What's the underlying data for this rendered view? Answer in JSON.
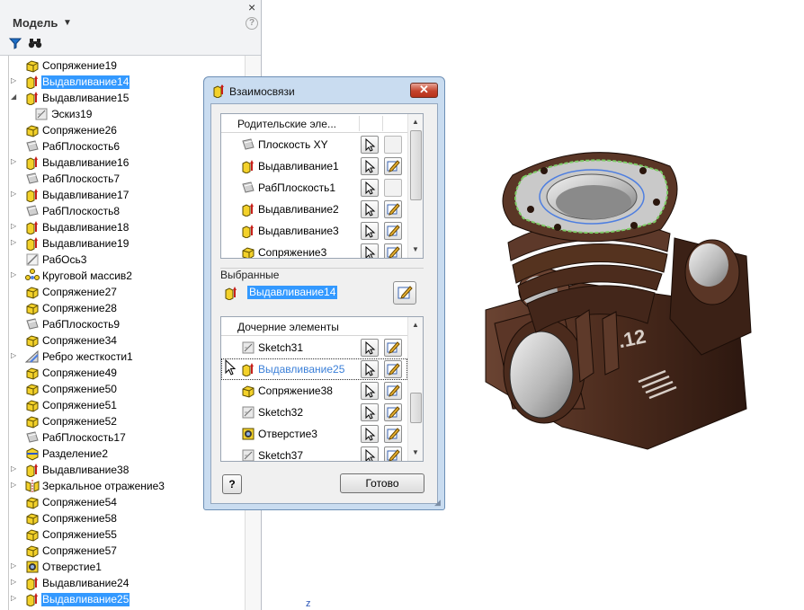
{
  "browser": {
    "title": "Модель",
    "close": "×",
    "help": "?",
    "items": [
      {
        "label": "Сопряжение19",
        "icon": "fillet-icon",
        "expandable": false,
        "selected": false,
        "child": false
      },
      {
        "label": "Выдавливание14",
        "icon": "extrude-icon",
        "expandable": true,
        "selected": true,
        "child": false
      },
      {
        "label": "Выдавливание15",
        "icon": "extrude-icon",
        "expandable": true,
        "expanded": true,
        "selected": false,
        "child": false
      },
      {
        "label": "Эскиз19",
        "icon": "sketch-icon",
        "expandable": false,
        "selected": false,
        "child": true
      },
      {
        "label": "Сопряжение26",
        "icon": "fillet-icon",
        "expandable": false,
        "selected": false,
        "child": false
      },
      {
        "label": "РабПлоскость6",
        "icon": "workplane-icon",
        "expandable": false,
        "selected": false,
        "child": false
      },
      {
        "label": "Выдавливание16",
        "icon": "extrude-icon",
        "expandable": true,
        "selected": false,
        "child": false
      },
      {
        "label": "РабПлоскость7",
        "icon": "workplane-icon",
        "expandable": false,
        "selected": false,
        "child": false
      },
      {
        "label": "Выдавливание17",
        "icon": "extrude-icon",
        "expandable": true,
        "selected": false,
        "child": false
      },
      {
        "label": "РабПлоскость8",
        "icon": "workplane-icon",
        "expandable": false,
        "selected": false,
        "child": false
      },
      {
        "label": "Выдавливание18",
        "icon": "extrude-icon",
        "expandable": true,
        "selected": false,
        "child": false
      },
      {
        "label": "Выдавливание19",
        "icon": "extrude-icon",
        "expandable": true,
        "selected": false,
        "child": false
      },
      {
        "label": "РабОсь3",
        "icon": "workaxis-icon",
        "expandable": false,
        "selected": false,
        "child": false
      },
      {
        "label": "Круговой массив2",
        "icon": "circular-pattern-icon",
        "expandable": true,
        "selected": false,
        "child": false
      },
      {
        "label": "Сопряжение27",
        "icon": "fillet-icon",
        "expandable": false,
        "selected": false,
        "child": false
      },
      {
        "label": "Сопряжение28",
        "icon": "fillet-icon",
        "expandable": false,
        "selected": false,
        "child": false
      },
      {
        "label": "РабПлоскость9",
        "icon": "workplane-icon",
        "expandable": false,
        "selected": false,
        "child": false
      },
      {
        "label": "Сопряжение34",
        "icon": "fillet-icon",
        "expandable": false,
        "selected": false,
        "child": false
      },
      {
        "label": "Ребро жесткости1",
        "icon": "rib-icon",
        "expandable": true,
        "selected": false,
        "child": false
      },
      {
        "label": "Сопряжение49",
        "icon": "fillet-icon",
        "expandable": false,
        "selected": false,
        "child": false
      },
      {
        "label": "Сопряжение50",
        "icon": "fillet-icon",
        "expandable": false,
        "selected": false,
        "child": false
      },
      {
        "label": "Сопряжение51",
        "icon": "fillet-icon",
        "expandable": false,
        "selected": false,
        "child": false
      },
      {
        "label": "Сопряжение52",
        "icon": "fillet-icon",
        "expandable": false,
        "selected": false,
        "child": false
      },
      {
        "label": "РабПлоскость17",
        "icon": "workplane-icon",
        "expandable": false,
        "selected": false,
        "child": false
      },
      {
        "label": "Разделение2",
        "icon": "split-icon",
        "expandable": false,
        "selected": false,
        "child": false
      },
      {
        "label": "Выдавливание38",
        "icon": "extrude-icon",
        "expandable": true,
        "selected": false,
        "child": false
      },
      {
        "label": "Зеркальное отражение3",
        "icon": "mirror-icon",
        "expandable": true,
        "selected": false,
        "child": false
      },
      {
        "label": "Сопряжение54",
        "icon": "fillet-icon",
        "expandable": false,
        "selected": false,
        "child": false
      },
      {
        "label": "Сопряжение58",
        "icon": "fillet-icon",
        "expandable": false,
        "selected": false,
        "child": false
      },
      {
        "label": "Сопряжение55",
        "icon": "fillet-icon",
        "expandable": false,
        "selected": false,
        "child": false
      },
      {
        "label": "Сопряжение57",
        "icon": "fillet-icon",
        "expandable": false,
        "selected": false,
        "child": false
      },
      {
        "label": "Отверстие1",
        "icon": "hole-icon",
        "expandable": true,
        "selected": false,
        "child": false
      },
      {
        "label": "Выдавливание24",
        "icon": "extrude-icon",
        "expandable": true,
        "selected": false,
        "child": false
      },
      {
        "label": "Выдавливание25",
        "icon": "extrude-icon",
        "expandable": true,
        "selected": true,
        "child": false
      }
    ]
  },
  "dialog": {
    "title": "Взаимосвязи",
    "close": "✕",
    "parents_header": "Родительские эле...",
    "parents": [
      {
        "label": "Плоскость XY",
        "icon": "workplane-icon",
        "editable": false
      },
      {
        "label": "Выдавливание1",
        "icon": "extrude-icon",
        "editable": true
      },
      {
        "label": "РабПлоскость1",
        "icon": "workplane-icon",
        "editable": false
      },
      {
        "label": "Выдавливание2",
        "icon": "extrude-icon",
        "editable": true
      },
      {
        "label": "Выдавливание3",
        "icon": "extrude-icon",
        "editable": true
      },
      {
        "label": "Сопряжение3",
        "icon": "fillet-icon",
        "editable": true
      }
    ],
    "selected_label": "Выбранные",
    "selected_item": "Выдавливание14",
    "children_header": "Дочерние элементы",
    "children": [
      {
        "label": "Sketch31",
        "icon": "sketch-icon",
        "focused": false
      },
      {
        "label": "Выдавливание25",
        "icon": "extrude-icon",
        "focused": true
      },
      {
        "label": "Сопряжение38",
        "icon": "fillet-icon",
        "focused": false
      },
      {
        "label": "Sketch32",
        "icon": "sketch-icon",
        "focused": false
      },
      {
        "label": "Отверстие3",
        "icon": "hole-icon",
        "focused": false
      },
      {
        "label": "Sketch37",
        "icon": "sketch-icon",
        "focused": false
      }
    ],
    "help": "?",
    "done": "Готово"
  },
  "viewport": {
    "axis_label": "z",
    "model_text": ".12"
  },
  "colors": {
    "selection": "#3399ff",
    "dialog_frame": "#c9dcf0",
    "model_body": "#4a2a1c"
  }
}
